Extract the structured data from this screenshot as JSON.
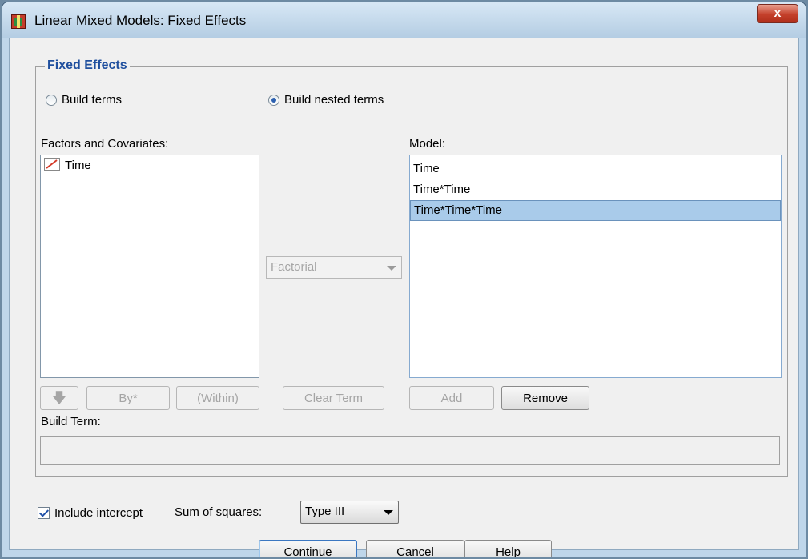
{
  "window": {
    "title": "Linear Mixed Models: Fixed Effects",
    "close_glyph": "x"
  },
  "group": {
    "legend": "Fixed Effects"
  },
  "radios": [
    {
      "label": "Build terms",
      "selected": false
    },
    {
      "label": "Build nested terms",
      "selected": true
    }
  ],
  "factors": {
    "label": "Factors and Covariates:",
    "items": [
      "Time"
    ]
  },
  "model": {
    "label": "Model:",
    "items": [
      "Time",
      "Time*Time",
      "Time*Time*Time"
    ],
    "selected_index": 2
  },
  "term_type": {
    "value": "Factorial",
    "enabled": false
  },
  "term_buttons": {
    "arrow_glyph": "🡇",
    "by_label": "By*",
    "within_label": "(Within)",
    "clear_label": "Clear Term",
    "add_label": "Add",
    "remove_label": "Remove"
  },
  "build_term": {
    "label": "Build Term:",
    "value": ""
  },
  "include_intercept": {
    "label": "Include intercept",
    "checked": true
  },
  "sum_of_squares": {
    "label": "Sum of squares:",
    "value": "Type III"
  },
  "footer": {
    "continue_label": "Continue",
    "cancel_label": "Cancel",
    "help_label": "Help"
  },
  "icons": {
    "app": "spss-app-icon",
    "scale-variable": "scale-variable-icon",
    "down-arrow": "down-arrow-icon"
  },
  "colors": {
    "legend": "#1f4f9e",
    "selection": "#a9cbea",
    "titlebar": "#bfd6ea",
    "close": "#c4402b"
  }
}
